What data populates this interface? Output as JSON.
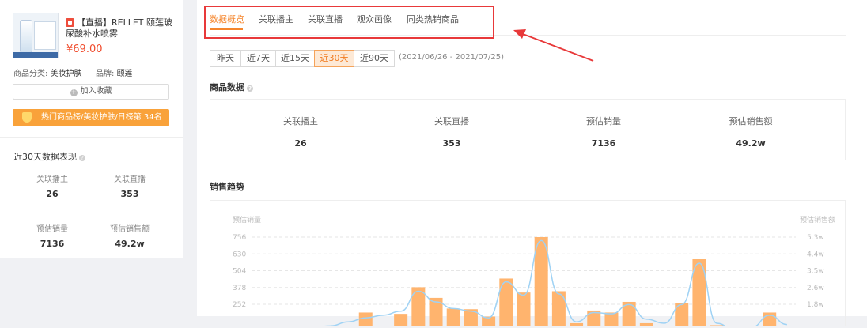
{
  "product": {
    "title": "【直播】RELLET 颐莲玻尿酸补水喷雾",
    "price": "¥69.00",
    "category_label": "商品分类:",
    "category": "美妆护肤",
    "brand_label": "品牌:",
    "brand": "颐莲",
    "favorite_button": "加入收藏",
    "rank_text": "热门商品榜/美妆护肤/日榜第 34名"
  },
  "sidebar_stats": {
    "title": "近30天数据表现",
    "items": [
      {
        "label": "关联播主",
        "value": "26"
      },
      {
        "label": "关联直播",
        "value": "353"
      },
      {
        "label": "预估销量",
        "value": "7136"
      },
      {
        "label": "预估销售额",
        "value": "49.2w"
      }
    ]
  },
  "tabs": [
    {
      "label": "数据概览",
      "active": true
    },
    {
      "label": "关联播主",
      "active": false
    },
    {
      "label": "关联直播",
      "active": false
    },
    {
      "label": "观众画像",
      "active": false
    },
    {
      "label": "同类热销商品",
      "active": false
    }
  ],
  "date_ranges": {
    "buttons": [
      {
        "label": "昨天",
        "active": false
      },
      {
        "label": "近7天",
        "active": false
      },
      {
        "label": "近15天",
        "active": false
      },
      {
        "label": "近30天",
        "active": true
      },
      {
        "label": "近90天",
        "active": false
      }
    ],
    "range_text": "(2021/06/26 - 2021/07/25)"
  },
  "product_data": {
    "title": "商品数据",
    "items": [
      {
        "label": "关联播主",
        "value": "26"
      },
      {
        "label": "关联直播",
        "value": "353"
      },
      {
        "label": "预估销量",
        "value": "7136"
      },
      {
        "label": "预估销售额",
        "value": "49.2w"
      }
    ]
  },
  "sales_trend": {
    "title": "销售趋势"
  },
  "colors": {
    "accent": "#f5862d",
    "bar": "#ffb46e",
    "line": "#9fd2f4",
    "highlight_box": "#e8393a",
    "price": "#f04b2c"
  },
  "chart_data": {
    "type": "bar",
    "left_axis_label": "预估销量",
    "right_axis_label": "预估销售额",
    "left_ticks": [
      "756",
      "630",
      "504",
      "378",
      "252"
    ],
    "right_ticks": [
      "5.3w",
      "4.4w",
      "3.5w",
      "2.6w",
      "1.8w"
    ],
    "left_tick_values": [
      756,
      630,
      504,
      378,
      252
    ],
    "ylim_left": [
      0,
      756
    ],
    "bar_values": [
      0,
      0,
      0,
      0,
      0,
      0,
      190,
      0,
      180,
      380,
      300,
      220,
      215,
      160,
      445,
      340,
      756,
      350,
      110,
      205,
      190,
      270,
      110,
      0,
      260,
      590,
      95,
      0,
      0,
      190,
      0
    ],
    "line_values": [
      0,
      0,
      0,
      80,
      90,
      120,
      150,
      170,
      200,
      350,
      270,
      220,
      200,
      150,
      420,
      320,
      730,
      330,
      120,
      190,
      180,
      250,
      140,
      110,
      250,
      560,
      110,
      60,
      80,
      170,
      100
    ],
    "grid": true
  }
}
